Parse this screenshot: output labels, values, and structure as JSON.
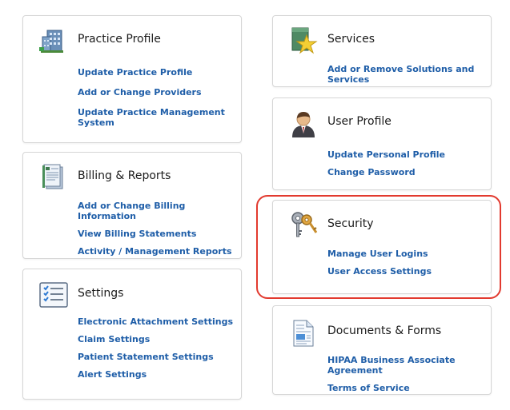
{
  "cards": {
    "practice": {
      "title": "Practice Profile",
      "links": [
        "Update Practice Profile",
        "Add or Change Providers",
        "Update Practice Management System"
      ]
    },
    "billing": {
      "title": "Billing & Reports",
      "links": [
        "Add or Change Billing Information",
        "View Billing Statements",
        "Activity / Management Reports"
      ]
    },
    "settings": {
      "title": "Settings",
      "links": [
        "Electronic Attachment Settings",
        "Claim Settings",
        "Patient Statement Settings",
        "Alert Settings"
      ]
    },
    "services": {
      "title": "Services",
      "links": [
        "Add or Remove Solutions and Services"
      ]
    },
    "user_profile": {
      "title": "User Profile",
      "links": [
        "Update Personal Profile",
        "Change Password"
      ]
    },
    "security": {
      "title": "Security",
      "links": [
        "Manage User Logins",
        "User Access Settings"
      ]
    },
    "documents": {
      "title": "Documents & Forms",
      "links": [
        "HIPAA Business Associate Agreement",
        "Terms of Service"
      ]
    }
  },
  "icons": {
    "practice": "building-icon",
    "billing": "report-icon",
    "settings": "checklist-icon",
    "services": "star-box-icon",
    "user_profile": "user-icon",
    "security": "keys-icon",
    "documents": "document-icon"
  },
  "colors": {
    "link": "#1f5ea8",
    "highlight": "#e23a2f",
    "border": "#d6d6d6"
  }
}
